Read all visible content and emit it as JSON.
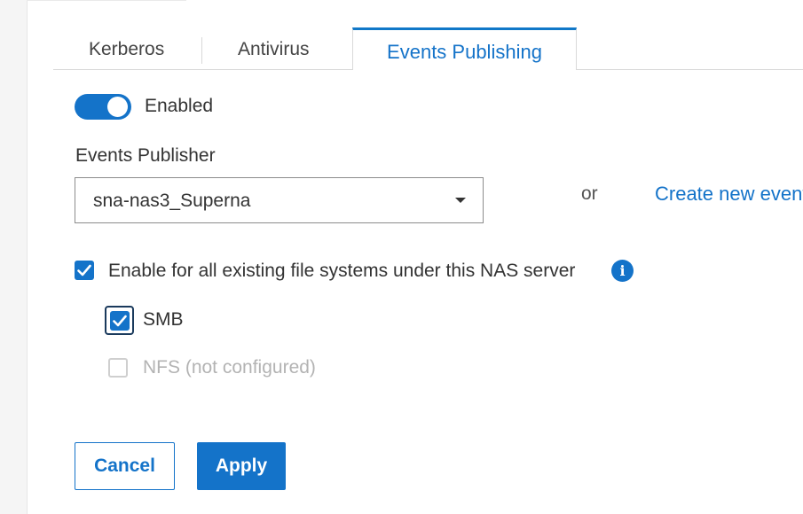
{
  "tabs": [
    {
      "label": "Kerberos",
      "active": false
    },
    {
      "label": "Antivirus",
      "active": false
    },
    {
      "label": "Events Publishing",
      "active": true
    }
  ],
  "toggle": {
    "label": "Enabled",
    "on": true
  },
  "events_publisher": {
    "label": "Events Publisher",
    "selected": "sna-nas3_Superna",
    "or_text": "or",
    "create_link": "Create new event"
  },
  "options": {
    "all_fs": {
      "label": "Enable for all existing file systems under this NAS server",
      "checked": true,
      "info_icon": "info-icon"
    },
    "smb": {
      "label": "SMB",
      "checked": true
    },
    "nfs": {
      "label": "NFS (not configured)",
      "checked": false,
      "disabled": true
    }
  },
  "buttons": {
    "cancel": "Cancel",
    "apply": "Apply"
  },
  "colors": {
    "accent": "#1473c9",
    "text": "#333333",
    "disabled": "#b3b3b3"
  }
}
